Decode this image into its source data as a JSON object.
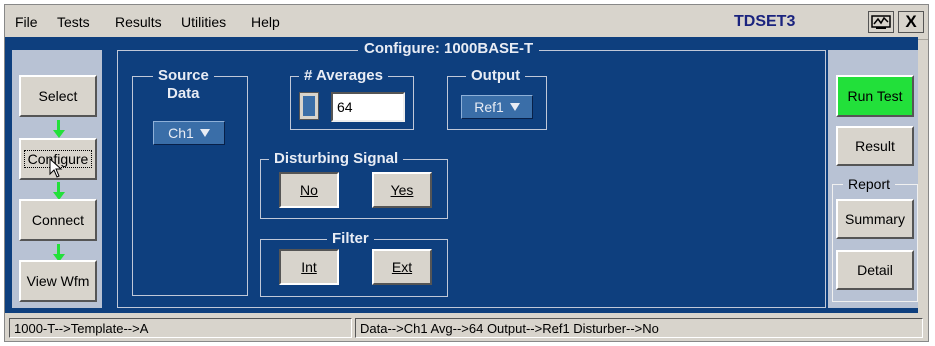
{
  "menu": {
    "items": [
      "File",
      "Tests",
      "Results",
      "Utilities",
      "Help"
    ],
    "app_title": "TDSET3",
    "close_label": "X"
  },
  "left_nav": {
    "select": "Select",
    "configure": "Configure",
    "connect": "Connect",
    "view_wfm": "View Wfm"
  },
  "right_nav": {
    "run_test": "Run Test",
    "result": "Result",
    "report_group": "Report",
    "summary": "Summary",
    "detail": "Detail"
  },
  "panel": {
    "title": "Configure: 1000BASE-T",
    "source": {
      "title": "Source",
      "subtitle": "Data",
      "value": "Ch1"
    },
    "averages": {
      "title": "# Averages",
      "value": "64"
    },
    "output": {
      "title": "Output",
      "value": "Ref1"
    },
    "disturbing": {
      "title": "Disturbing Signal",
      "no": "No",
      "yes": "Yes",
      "selected": "No"
    },
    "filter": {
      "title": "Filter",
      "int": "Int",
      "ext": "Ext",
      "selected": "Int"
    }
  },
  "status": {
    "left": "1000-T-->Template-->A",
    "right": "Data-->Ch1  Avg-->64  Output-->Ref1  Disturber-->No"
  },
  "colors": {
    "panel_bg": "#0e3f7e",
    "accent_green": "#22e03a",
    "side_panel": "#b8c2d4",
    "dropdown": "#3a6ea8"
  }
}
